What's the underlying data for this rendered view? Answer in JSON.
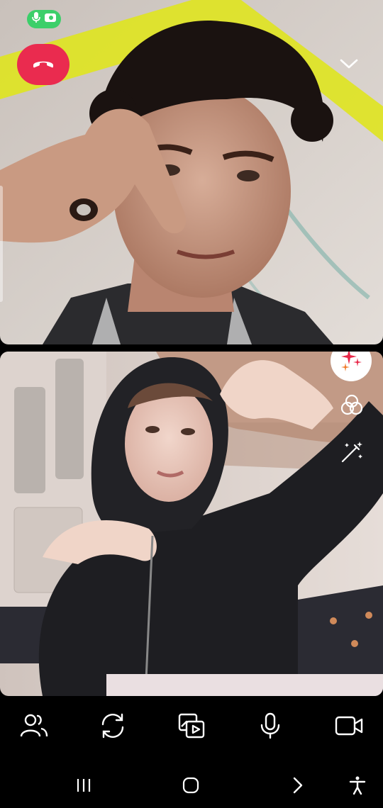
{
  "call": {
    "status": {
      "mic": "mic-icon",
      "camera": "camera-icon",
      "color": "#3ccf6a"
    },
    "end_call": {
      "icon": "phone-hangup-icon",
      "color": "#ea2b4f"
    },
    "collapse": {
      "icon": "chevron-down-icon"
    }
  },
  "remote_video": {
    "content": "remote-video-feed"
  },
  "local_video": {
    "content": "local-video-feed"
  },
  "effects": {
    "sparkle": {
      "icon": "sparkle-icon"
    },
    "filter": {
      "icon": "filter-icon"
    },
    "beauty": {
      "icon": "magic-wand-icon"
    }
  },
  "controls": [
    {
      "id": "participants",
      "icon": "people-icon"
    },
    {
      "id": "switch_camera",
      "icon": "switch-camera-icon"
    },
    {
      "id": "share_media",
      "icon": "media-share-icon"
    },
    {
      "id": "microphone",
      "icon": "mic-icon"
    },
    {
      "id": "camera",
      "icon": "video-camera-icon"
    }
  ],
  "navbar": {
    "recents": "recents-icon",
    "home": "home-icon",
    "back": "back-icon",
    "accessibility": "accessibility-icon"
  }
}
